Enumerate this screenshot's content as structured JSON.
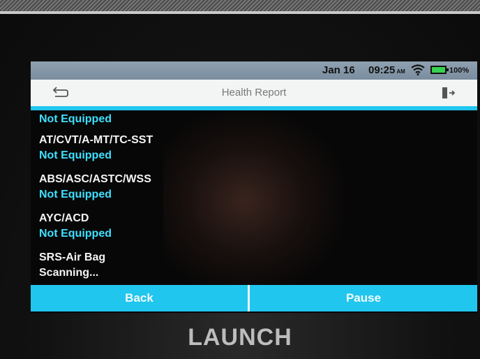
{
  "status_bar": {
    "date": "Jan 16",
    "time": "09:25",
    "ampm": "AM",
    "battery_percent": "100%",
    "wifi_icon": "wifi-icon",
    "battery_icon": "battery-icon"
  },
  "header": {
    "title": "Health Report",
    "back_icon": "back-arrow-icon",
    "exit_icon": "exit-icon"
  },
  "items": [
    {
      "name": "",
      "status": "Not Equipped"
    },
    {
      "name": "AT/CVT/A-MT/TC-SST",
      "status": "Not Equipped"
    },
    {
      "name": "ABS/ASC/ASTC/WSS",
      "status": "Not Equipped"
    },
    {
      "name": "AYC/ACD",
      "status": "Not Equipped"
    },
    {
      "name": "SRS-Air Bag",
      "status": "Scanning..."
    }
  ],
  "footer": {
    "back_label": "Back",
    "pause_label": "Pause"
  },
  "brand": "LAUNCH",
  "colors": {
    "accent": "#20c6ee",
    "status_text": "#3fe0ff",
    "screen_bg": "#070707"
  }
}
